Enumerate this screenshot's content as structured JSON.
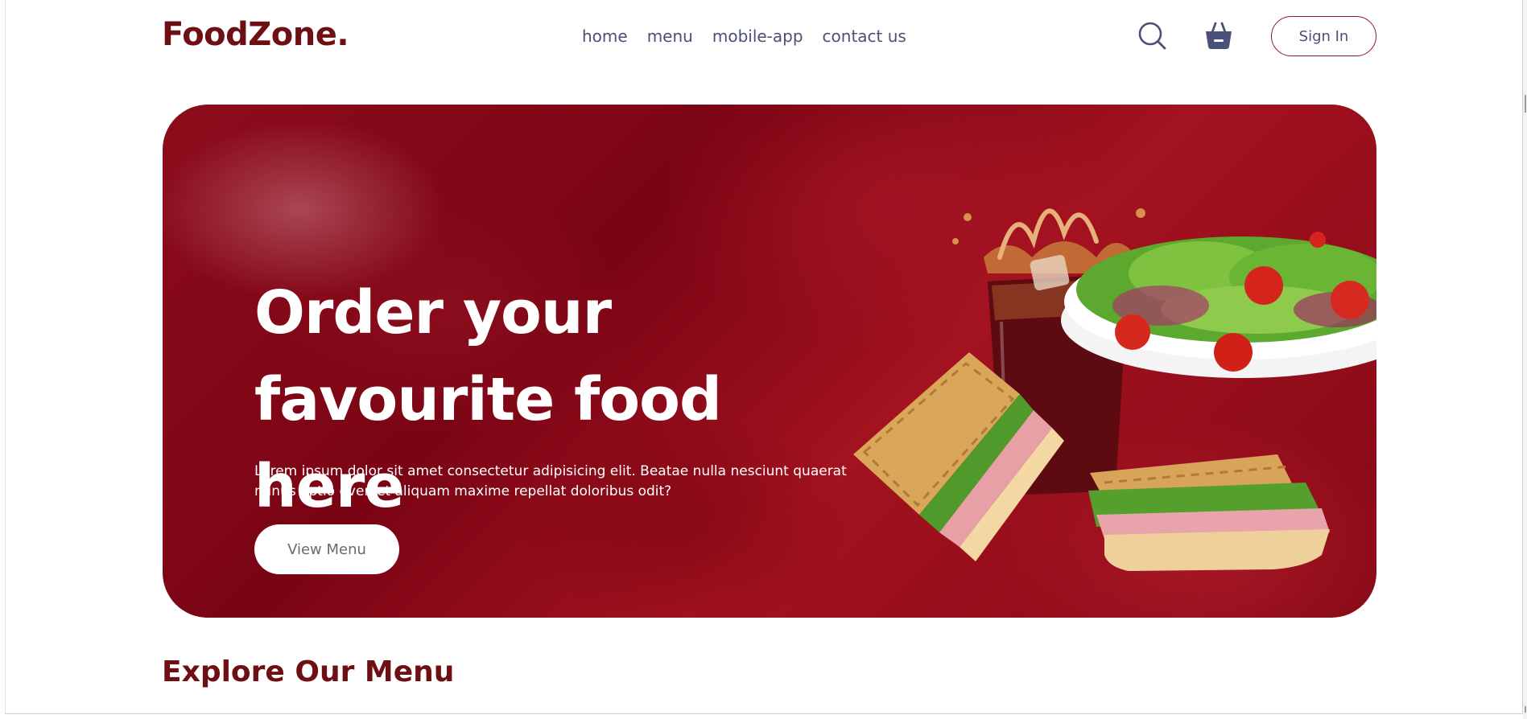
{
  "brand": {
    "logo_text": "FoodZone."
  },
  "nav": {
    "items": [
      {
        "label": "home"
      },
      {
        "label": "menu"
      },
      {
        "label": "mobile-app"
      },
      {
        "label": "contact us"
      }
    ]
  },
  "header": {
    "search_icon": "search-icon",
    "basket_icon": "basket-icon",
    "signin_label": "Sign In"
  },
  "hero": {
    "title_line1": "Order your",
    "title_line2": "favourite food here",
    "description": "Lorem ipsum dolor sit amet consectetur adipisicing elit. Beatae nulla nesciunt quaerat minus optio eveniet aliquam maxime repellat doloribus odit?",
    "button_label": "View Menu"
  },
  "section": {
    "title": "Explore Our Menu"
  },
  "colors": {
    "brand": "#6e0f14",
    "nav_text": "#4a5078",
    "hero_bg": "#7a0414"
  }
}
